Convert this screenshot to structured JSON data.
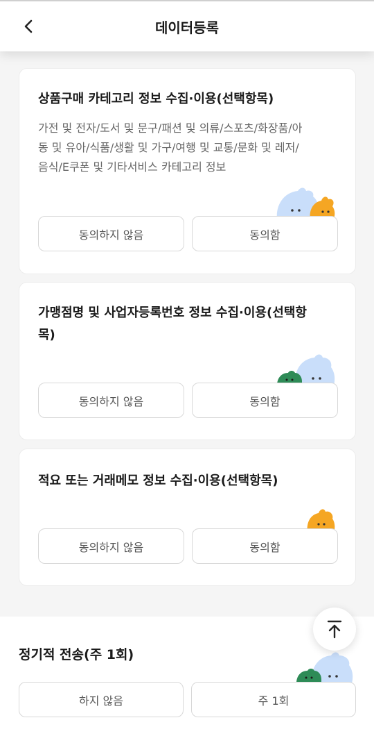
{
  "header": {
    "title": "데이터등록",
    "back_icon": "chevron-left-icon"
  },
  "cards": [
    {
      "title": "상품구매 카테고리 정보 수집·이용(선택항목)",
      "description_lines": [
        "가전 및 전자/도서 및 문구/패션 및 의류/스포츠/화장품/아",
        "동 및 유아/식품/생활 및 가구/여행 및 교통/문화 및 레저/",
        "음식/E쿠폰 및 기타서비스 카테고리 정보"
      ],
      "decline_label": "동의하지 않음",
      "agree_label": "동의함"
    },
    {
      "title_lines": [
        "가맹점명 및 사업자등록번호 정보 수집·이용(선택항",
        "목)"
      ],
      "decline_label": "동의하지 않음",
      "agree_label": "동의함"
    },
    {
      "title": "적요 또는 거래메모 정보 수집·이용(선택항목)",
      "decline_label": "동의하지 않음",
      "agree_label": "동의함"
    }
  ],
  "regular_transfer": {
    "title": "정기적 전송(주 1회)",
    "decline_label": "하지 않음",
    "weekly_label": "주 1회"
  },
  "scroll_top": {
    "icon": "arrow-up-to-top-icon"
  },
  "colors": {
    "mascot_blue": "#c9defa",
    "mascot_orange": "#f5a623",
    "mascot_green": "#2e8b57",
    "card_border": "#ececec",
    "button_border": "#d8d8d8"
  }
}
